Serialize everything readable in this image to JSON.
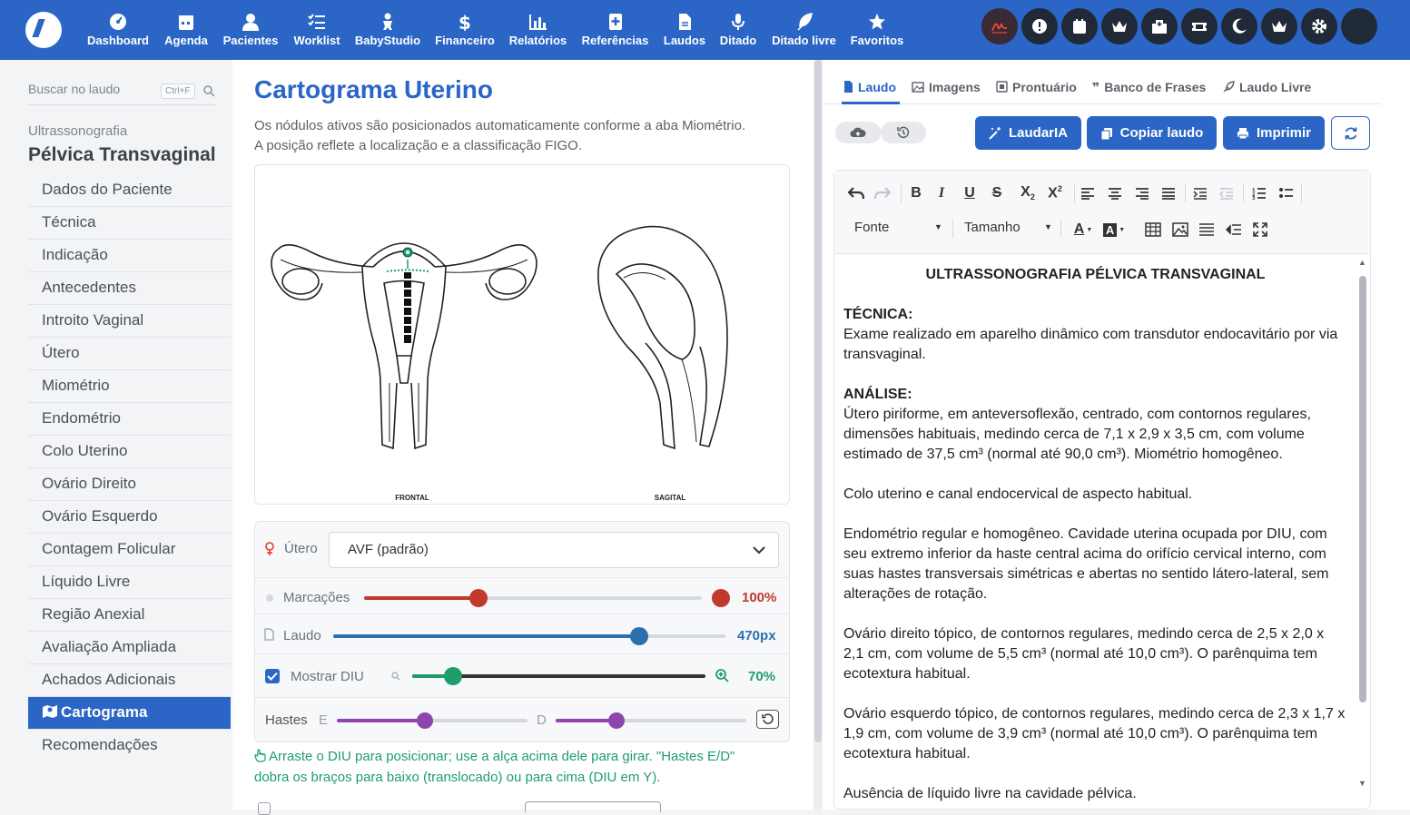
{
  "topnav": {
    "items": [
      {
        "label": "Dashboard",
        "icon": "dashboard-icon"
      },
      {
        "label": "Agenda",
        "icon": "calendar-icon"
      },
      {
        "label": "Pacientes",
        "icon": "user-icon"
      },
      {
        "label": "Worklist",
        "icon": "list-check-icon"
      },
      {
        "label": "BabyStudio",
        "icon": "baby-icon"
      },
      {
        "label": "Financeiro",
        "icon": "dollar-icon"
      },
      {
        "label": "Relatórios",
        "icon": "bar-chart-icon"
      },
      {
        "label": "Referências",
        "icon": "book-plus-icon"
      },
      {
        "label": "Laudos",
        "icon": "document-icon"
      },
      {
        "label": "Ditado",
        "icon": "microphone-icon"
      },
      {
        "label": "Ditado livre",
        "icon": "feather-icon"
      },
      {
        "label": "Favoritos",
        "icon": "star-icon"
      }
    ],
    "right_icons": [
      "signature-icon",
      "alert-icon",
      "calendar-icon",
      "crown-icon",
      "hospital-icon",
      "ticket-icon",
      "moon-icon",
      "crown-icon",
      "gear-icon",
      "avatar"
    ]
  },
  "sidebar": {
    "search_placeholder": "Buscar no laudo",
    "search_shortcut": "Ctrl+F",
    "section_category": "Ultrassonografia",
    "section_title": "Pélvica Transvaginal",
    "items": [
      "Dados do Paciente",
      "Técnica",
      "Indicação",
      "Antecedentes",
      "Introito Vaginal",
      "Útero",
      "Miométrio",
      "Endométrio",
      "Colo Uterino",
      "Ovário Direito",
      "Ovário Esquerdo",
      "Contagem Folicular",
      "Líquido Livre",
      "Região Anexial",
      "Avaliação Ampliada",
      "Achados Adicionais",
      "Cartograma",
      "Recomendações"
    ],
    "active_item": "Cartograma"
  },
  "cartograma": {
    "title": "Cartograma Uterino",
    "description_line1": "Os nódulos ativos são posicionados automaticamente conforme a aba Miométrio.",
    "description_line2": "A posição reflete a localização e a classificação FIGO.",
    "diagram_label_frontal": "FRONTAL",
    "diagram_label_sagital": "SAGITAL",
    "controls": {
      "utero_label": "Útero",
      "utero_value": "AVF (padrão)",
      "marcacoes_label": "Marcações",
      "marcacoes_value": "100%",
      "marcacoes_fraction": 0.34,
      "laudo_label": "Laudo",
      "laudo_value": "470px",
      "laudo_fraction": 0.78,
      "mostrar_diu_label": "Mostrar DIU",
      "mostrar_diu_checked": true,
      "diu_zoom_value": "70%",
      "diu_zoom_fraction": 0.14,
      "hastes_label": "Hastes",
      "hastes_e_label": "E",
      "hastes_d_label": "D",
      "hastes_e_fraction": 0.46,
      "hastes_d_fraction": 0.32
    },
    "hint_line1": "Arraste o DIU para posicionar; use a alça acima dele para girar. \"Hastes E/D\"",
    "hint_line2": "dobra os braços para baixo (translocado) ou para cima (DIU em Y)."
  },
  "right_panel": {
    "tabs": [
      "Laudo",
      "Imagens",
      "Prontuário",
      "Banco de Frases",
      "Laudo Livre"
    ],
    "active_tab": "Laudo",
    "buttons": {
      "laudaria": "LaudarIA",
      "copiar": "Copiar laudo",
      "imprimir": "Imprimir"
    },
    "editor_selects": {
      "font": "Fonte",
      "size": "Tamanho"
    },
    "report": {
      "title": "ULTRASSONOGRAFIA PÉLVICA TRANSVAGINAL",
      "tecnica_heading": "TÉCNICA:",
      "tecnica_text": "Exame realizado em aparelho dinâmico com transdutor endocavitário por via transvaginal.",
      "analise_heading": "ANÁLISE:",
      "analise_text": "Útero piriforme, em anteversoflexão, centrado, com contornos regulares, dimensões habituais, medindo cerca de 7,1 x 2,9 x 3,5 cm, com volume estimado de 37,5 cm³ (normal até 90,0 cm³). Miométrio homogêneo.",
      "colo_text": "Colo uterino e canal endocervical de aspecto habitual.",
      "endometrio_text": "Endométrio regular e homogêneo. Cavidade uterina ocupada por DIU, com seu extremo inferior da haste central acima do orifício cervical interno, com suas hastes transversais simétricas e abertas no sentido látero-lateral, sem alterações de rotação.",
      "ovario_d_text": "Ovário direito tópico, de contornos regulares, medindo cerca de 2,5 x 2,0 x 2,1 cm, com volume de 5,5 cm³ (normal até 10,0 cm³). O parênquima tem ecotextura habitual.",
      "ovario_e_text": "Ovário esquerdo tópico, de contornos regulares, medindo cerca de 2,3 x 1,7 x 1,9 cm, com volume de 3,9 cm³ (normal até 10,0 cm³). O parênquima tem ecotextura habitual.",
      "liquido_text": "Ausência de líquido livre na cavidade pélvica."
    }
  },
  "colors": {
    "primary": "#2b66c6",
    "marcacoes": "#c0392b",
    "laudo": "#2a6fb0",
    "diu": "#1f9d6b",
    "hastes": "#8e44ad",
    "dark_button": "#1f2937"
  }
}
